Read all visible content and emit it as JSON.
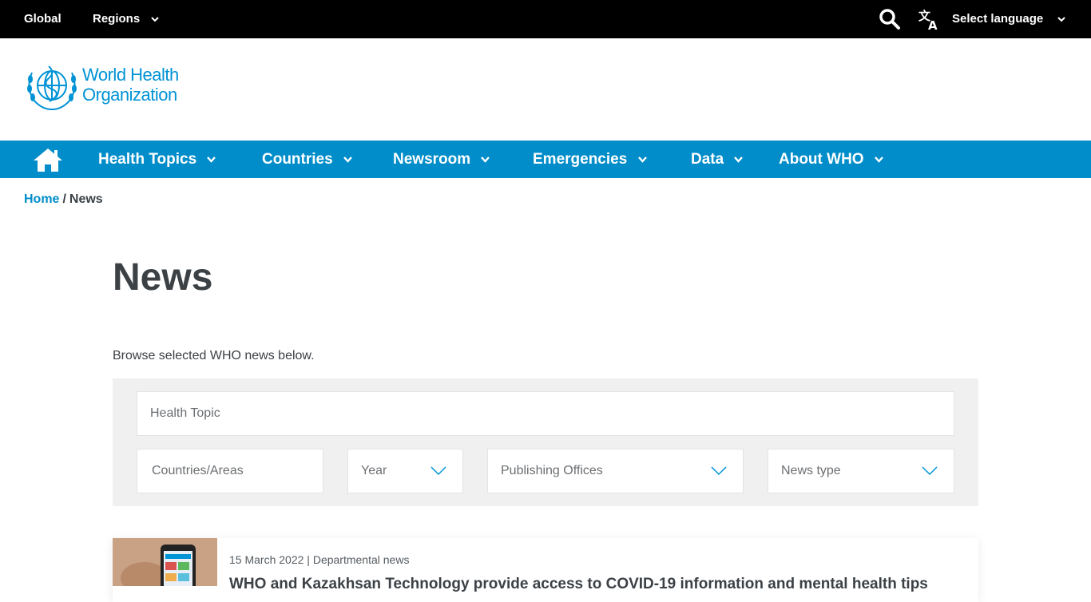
{
  "topbar": {
    "global_label": "Global",
    "regions_label": "Regions",
    "select_language_label": "Select language"
  },
  "logo": {
    "line1": "World Health",
    "line2": "Organization"
  },
  "nav": {
    "items": [
      {
        "label": "Health Topics"
      },
      {
        "label": "Countries"
      },
      {
        "label": "Newsroom"
      },
      {
        "label": "Emergencies"
      },
      {
        "label": "Data"
      },
      {
        "label": "About WHO"
      }
    ]
  },
  "breadcrumb": {
    "home": "Home",
    "separator": "/",
    "current": "News"
  },
  "page": {
    "title": "News",
    "intro": "Browse selected WHO news below."
  },
  "filters": {
    "health_topic_placeholder": "Health Topic",
    "countries_placeholder": "Countries/Areas",
    "year_placeholder": "Year",
    "publishing_offices_placeholder": "Publishing Offices",
    "news_type_placeholder": "News type"
  },
  "news": [
    {
      "date": "15 March 2022",
      "separator": "|",
      "type": "Departmental news",
      "headline": "WHO and Kazakhsan Technology provide access to COVID-19 information and mental health tips"
    }
  ],
  "colors": {
    "brand_blue": "#008dc9",
    "topbar_bg": "#000000",
    "filter_bg": "#f0f0f0",
    "text": "#3c4146"
  }
}
